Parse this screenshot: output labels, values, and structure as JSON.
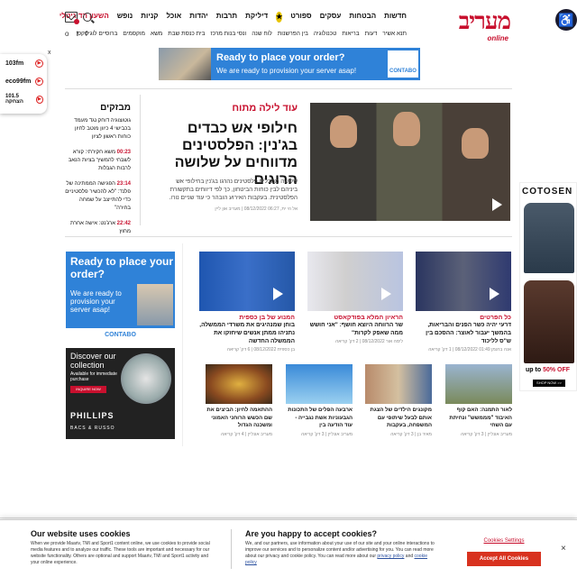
{
  "header": {
    "logo": "מעריב",
    "logo_sub": "online",
    "nav": [
      "חדשות",
      "הבטחות",
      "עסקים",
      "ספורט",
      "דיליקת",
      "תרבות",
      "יהדות",
      "אוכל",
      "קניות",
      "נופש",
      "השעון הדיגיטלי"
    ],
    "subnav": [
      "תנא אשיר",
      "דעות",
      "בריאות",
      "טכנולוגיה",
      "בין הפרשנות",
      "לוח שנה",
      "ונסי בנות מרכז",
      "בית כנסת שבת",
      "משא",
      "מוקסמים",
      "ברוסיים לוגיטקס"
    ],
    "social": [
      "f",
      "t",
      "o"
    ]
  },
  "radio": {
    "close": "x",
    "stations": [
      "103fm",
      "eco99fm",
      "101.5 הצחקה"
    ]
  },
  "top_ad": {
    "headline": "Ready to place your order?",
    "sub": "We are ready to provision your server asap!",
    "brand": "CONTABO"
  },
  "main_story": {
    "kicker": "עוד לילה מתוח",
    "headline": "חילופי אש כבדים בג'נין: הפלסטינים מדווחים על שלושה הרוגים",
    "summary": "שלושה מחבלים פלסטינים נהרגו בג'נין בחילופי אש ביניהם לבין כוחות הביטחון, כך לפי דיווחים בתקשורת הפלסטינית. בעקבות האירוע הובהר כי עוד שניים נורו.",
    "meta": "אל הי ית, 06:27 08/12/2022 | מעריב און ליין"
  },
  "flashes": {
    "title": "מבזקים",
    "items": [
      {
        "time": "",
        "text": "גוטוצוגיה דוחק נגד מעמד בכבישי 4 כיוון מוטב לחיון כוחות ראשון לציון"
      },
      {
        "time": "00:23",
        "text": "משא חקירתי: קורא לשבחי להמשיך בציות הנאב לרבות הגבלות"
      },
      {
        "time": "23:14",
        "text": "הפגישה הממתינה של פלנד: \"לא להכשיר פלסטיניים כדי להתייצב על שמחה בחירה\""
      },
      {
        "time": "22:42",
        "text": "ארג'נט: אישה אחרת מחוץ"
      }
    ]
  },
  "cards": [
    {
      "kicker": "כל הפרטים",
      "title": "דרעי יהיה כשר הפנים והבריאות, בהמשך יעבור לאוצר: ההסכם בין ש\"ס לליכוד",
      "meta": "אנה ברגמן 01:49 08/12/2022 | 1 דק' קריאה"
    },
    {
      "kicker": "הראיון המלא בפודקאסט",
      "title": "שר הרווחה היוצא חושף: \"אני חושש ממה שאפק לקרות\"",
      "meta": "לימה אור 08/12/2022 | 2 דק' קריאה"
    },
    {
      "kicker": "המנוע של בן כספית",
      "title": "בוחן שמנהיגים את משרדי הממשלה, נתניהו ממתן אנשים שיחזקו את הממשלה החדשה",
      "meta": "בן כספית 08/12/2022 | 6 דק' קריאה"
    }
  ],
  "small_cards": [
    {
      "title": "לאור התמנה: האם קוף האיבוד \"מממשש\" ונחיתת עם השחי",
      "meta": "מעריב אונליין | 3 דק' קריאה"
    },
    {
      "title": "מקונגים הילדים של הצגת אותם לבעל שיתופי עם המשפחה, בעקבות",
      "meta": "מאיר בן | 3 דק' קריאה"
    },
    {
      "title": "ארבעה הפלים של התכונות הגבעוניות אשת נגבייה - עוד הודעה בין",
      "meta": "מעריב אונליין | 3 דק' קריאה"
    },
    {
      "title": "ההתאמה לחיון: הביצים את שם הכשש הרוחני האמוני ומשכנה הגדול",
      "meta": "מעריב אונליין | 4 דק' קריאה"
    }
  ],
  "ad_contabo": {
    "headline": "Ready to place your order?",
    "sub": "We are ready to provision your server asap!",
    "brand": "CONTABO"
  },
  "ad_phillips": {
    "headline": "Discover our collection",
    "sub": "Available for immediate purchase",
    "button": "INQUIRE NOW",
    "brand": "PHILLIPS",
    "sub_brand": "BACS & RUSSO"
  },
  "right_ad": {
    "brand": "COTOSEN",
    "offer_prefix": "up to ",
    "offer": "50% OFF",
    "button": "SHOP NOW >>"
  },
  "cookie": {
    "title1": "Our website uses cookies",
    "text1": "When we provide Maariv, TMI and Sport1 content online, we use cookies to provide social media features and to analyze our traffic. These tools are important and necessary for our website functionality. Others are optional and support Maariv, TMI and Sport1 activity and your online experience.",
    "title2": "Are you happy to accept cookies?",
    "text2": "We, and our partners, use information about your use of our site and your online interactions to improve our services and to personalize content and/or advertising for you. You can read more about our privacy and cookie policy. You can read more about our",
    "privacy": "privacy policy",
    "and": "and",
    "cookie_policy": "cookie policy",
    "settings": "Cookies Settings",
    "accept": "Accept All Cookies",
    "close": "×"
  },
  "colors": {
    "brand": "#c8102e",
    "ad_blue": "#2f82d8",
    "accept": "#d8321f"
  }
}
